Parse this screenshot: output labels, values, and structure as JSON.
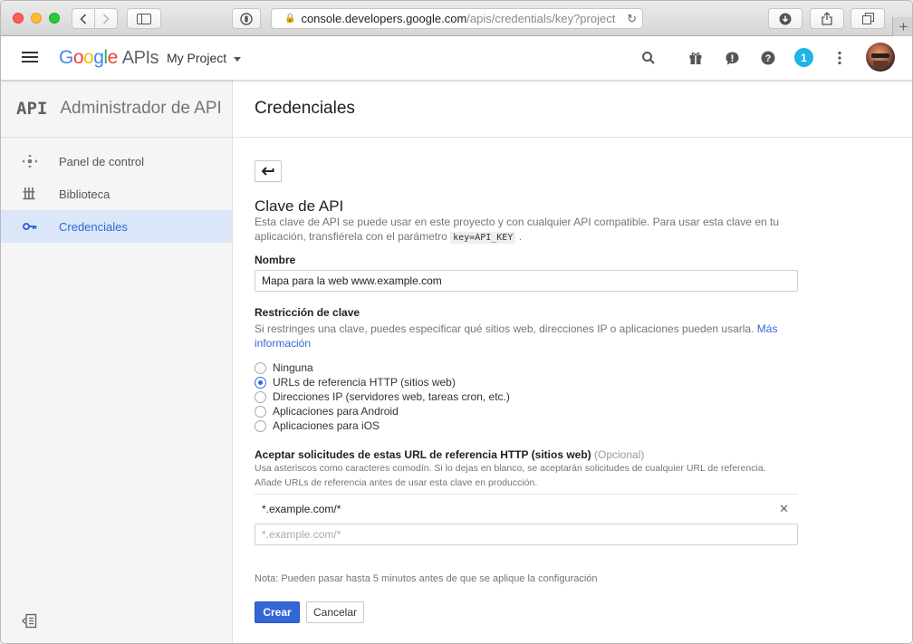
{
  "browser": {
    "url_host": "console.developers.google.com",
    "url_path": "/apis/credentials/key?project"
  },
  "header": {
    "logo_letters": [
      "G",
      "o",
      "o",
      "g",
      "l",
      "e"
    ],
    "logo_suffix": "APIs",
    "project_name": "My Project",
    "notification_count": "1",
    "icons": [
      "menu-icon",
      "search-icon",
      "gift-icon",
      "feedback-icon",
      "help-icon",
      "more-vert-icon"
    ]
  },
  "sidebar": {
    "brand_mark": "API",
    "title": "Administrador de APIs",
    "items": [
      {
        "label": "Panel de control",
        "icon": "dashboard-icon",
        "active": false
      },
      {
        "label": "Biblioteca",
        "icon": "library-icon",
        "active": false
      },
      {
        "label": "Credenciales",
        "icon": "key-icon",
        "active": true
      }
    ]
  },
  "main": {
    "page_title": "Credenciales",
    "section_title": "Clave de API",
    "description_1": "Esta clave de API se puede usar en este proyecto y con cualquier API compatible. Para usar esta clave en tu aplicación, transfiérela con el parámetro",
    "description_code": "key=API_KEY",
    "description_end": ".",
    "name_label": "Nombre",
    "name_value": "Mapa para la web www.example.com",
    "restriction_label": "Restricción de clave",
    "restriction_desc": "Si restringes una clave, puedes especificar qué sitios web, direcciones IP o aplicaciones pueden usarla.",
    "more_info_link": "Más información",
    "restriction_options": [
      {
        "label": "Ninguna",
        "selected": false
      },
      {
        "label": "URLs de referencia HTTP (sitios web)",
        "selected": true
      },
      {
        "label": "Direcciones IP (servidores web, tareas cron, etc.)",
        "selected": false
      },
      {
        "label": "Aplicaciones para Android",
        "selected": false
      },
      {
        "label": "Aplicaciones para iOS",
        "selected": false
      }
    ],
    "referrers_label": "Aceptar solicitudes de estas URL de referencia HTTP (sitios web)",
    "referrers_optional": "(Opcional)",
    "referrers_desc_1": "Usa asteriscos como caracteres comodín. Si lo dejas en blanco, se aceptarán solicitudes de cualquier URL de referencia.",
    "referrers_desc_2": "Añade URLs de referencia antes de usar esta clave en producción.",
    "referrer_entries": [
      "*.example.com/*"
    ],
    "referrer_placeholder": "*.example.com/*",
    "note": "Nota: Pueden pasar hasta 5 minutos antes de que se aplique la configuración",
    "create_label": "Crear",
    "cancel_label": "Cancelar"
  },
  "colors": {
    "accent": "#3367d6",
    "active_nav_bg": "#dbe6f8",
    "notification": "#1db4e8"
  }
}
